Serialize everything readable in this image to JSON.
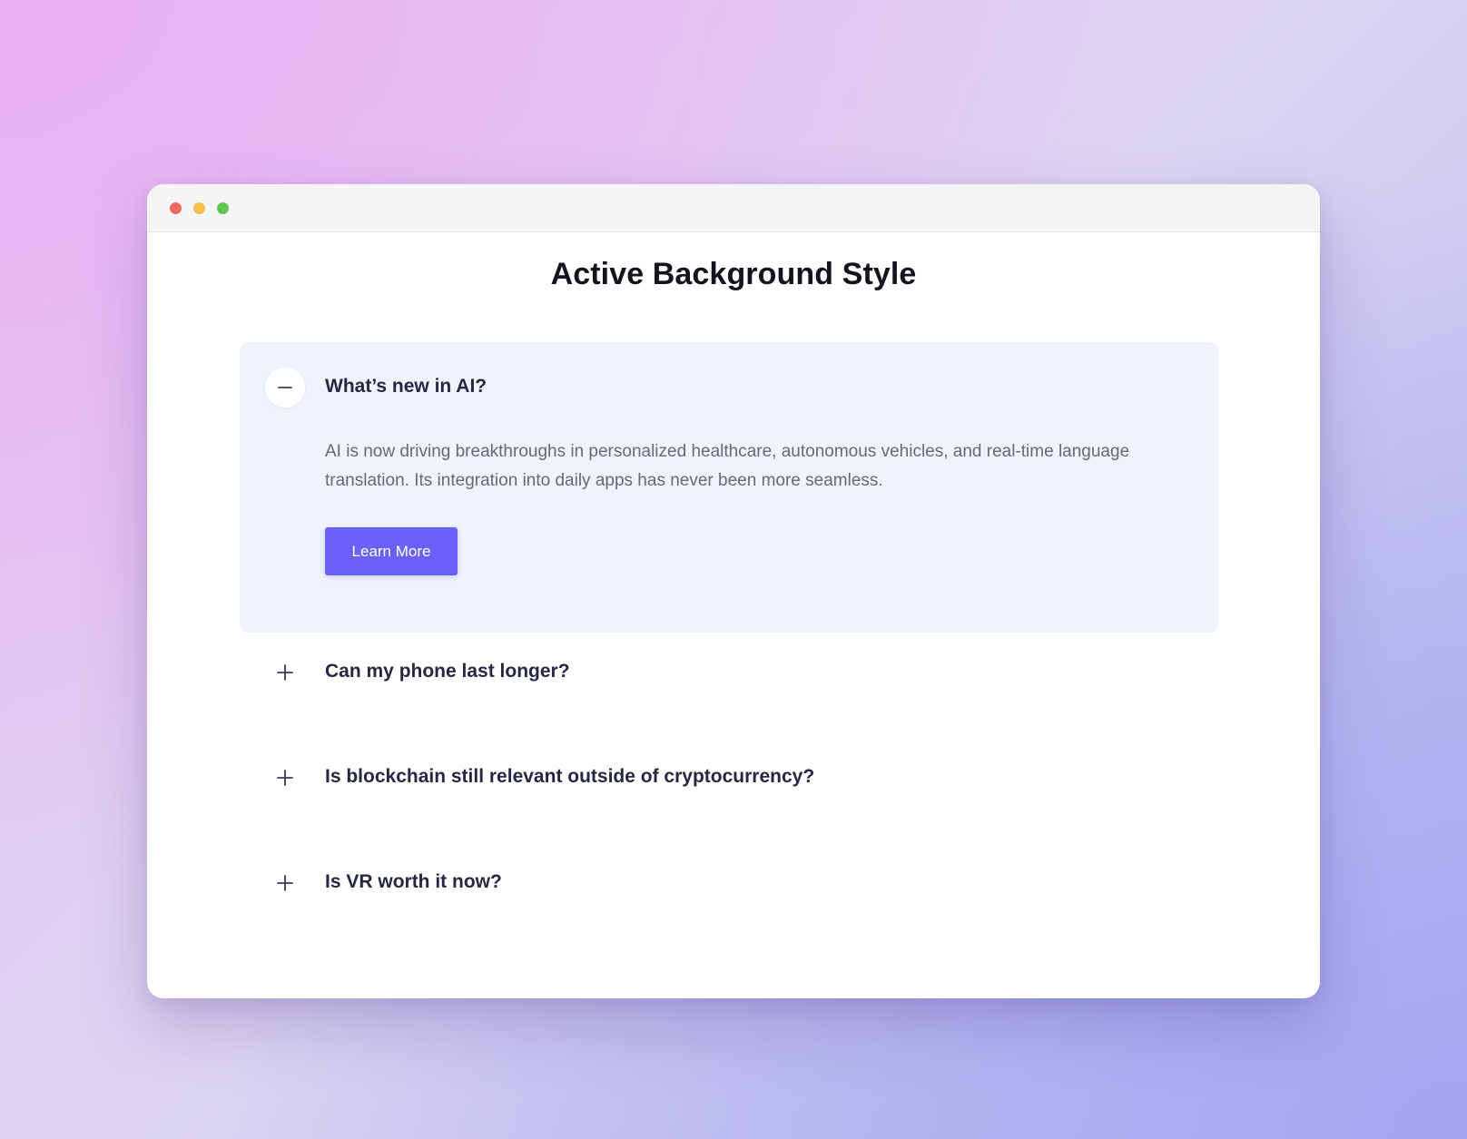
{
  "window": {
    "controls": [
      "close",
      "minimize",
      "maximize"
    ]
  },
  "page": {
    "title": "Active Background Style"
  },
  "accordion": {
    "items": [
      {
        "question": "What’s new in AI?",
        "expanded": true,
        "toggle_icon": "minus-icon",
        "answer": "AI is now driving breakthroughs in personalized healthcare, autonomous vehicles, and real-time language translation. Its integration into daily apps has never been more seamless.",
        "button_label": "Learn More"
      },
      {
        "question": "Can my phone last longer?",
        "expanded": false,
        "toggle_icon": "plus-icon"
      },
      {
        "question": "Is blockchain still relevant outside of cryptocurrency?",
        "expanded": false,
        "toggle_icon": "plus-icon"
      },
      {
        "question": "Is VR worth it now?",
        "expanded": false,
        "toggle_icon": "plus-icon"
      }
    ]
  },
  "colors": {
    "accent": "#6b60f7",
    "active_background": "#eff3fc",
    "question_text": "#262842",
    "answer_text": "#666a78"
  }
}
